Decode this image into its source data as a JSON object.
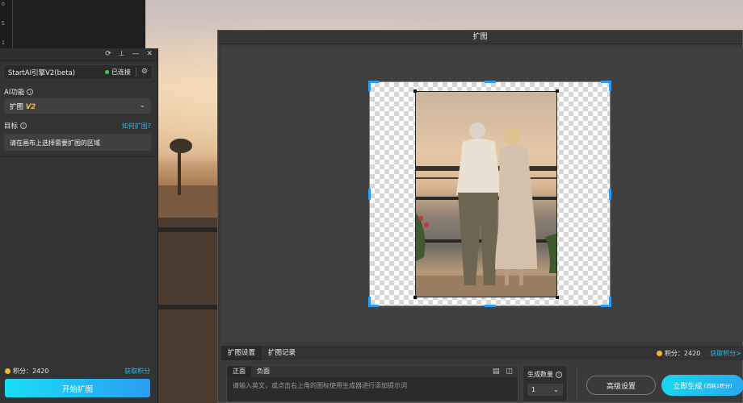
{
  "ruler": {
    "marks": [
      "0",
      "5",
      "1"
    ]
  },
  "panel": {
    "engine": {
      "name": "StartAI引擎V2(beta)",
      "status": "已连接",
      "status_color": "#3ad24a"
    },
    "ai_function": {
      "label": "AI功能",
      "value_prefix": "扩图",
      "value_tag": "V2"
    },
    "goal": {
      "label": "目标",
      "help_link": "如何扩图?",
      "hint": "请在画布上选择需要扩图的区域"
    },
    "points": {
      "label": "积分：2420",
      "get": "获取积分"
    },
    "start_button": "开始扩图"
  },
  "dialog": {
    "title": "扩图",
    "tabs": [
      "扩图设置",
      "扩图记录"
    ],
    "points": "积分：2420",
    "get_points": "获取积分>",
    "prompt_tabs": [
      "正面",
      "负面"
    ],
    "prompt_placeholder": "请输入英文，或点击右上角的图标使用生成器进行添加提示词",
    "count": {
      "label": "生成数量",
      "value": "1"
    },
    "advanced_button": "高级设置",
    "generate_button": "立即生成",
    "generate_cost": "(消耗1积分)"
  },
  "colors": {
    "accent": "#2d9bf0",
    "brand_gradient_start": "#18dff4",
    "points_coin": "#f5b72b",
    "version_tag": "#f3c23b"
  }
}
